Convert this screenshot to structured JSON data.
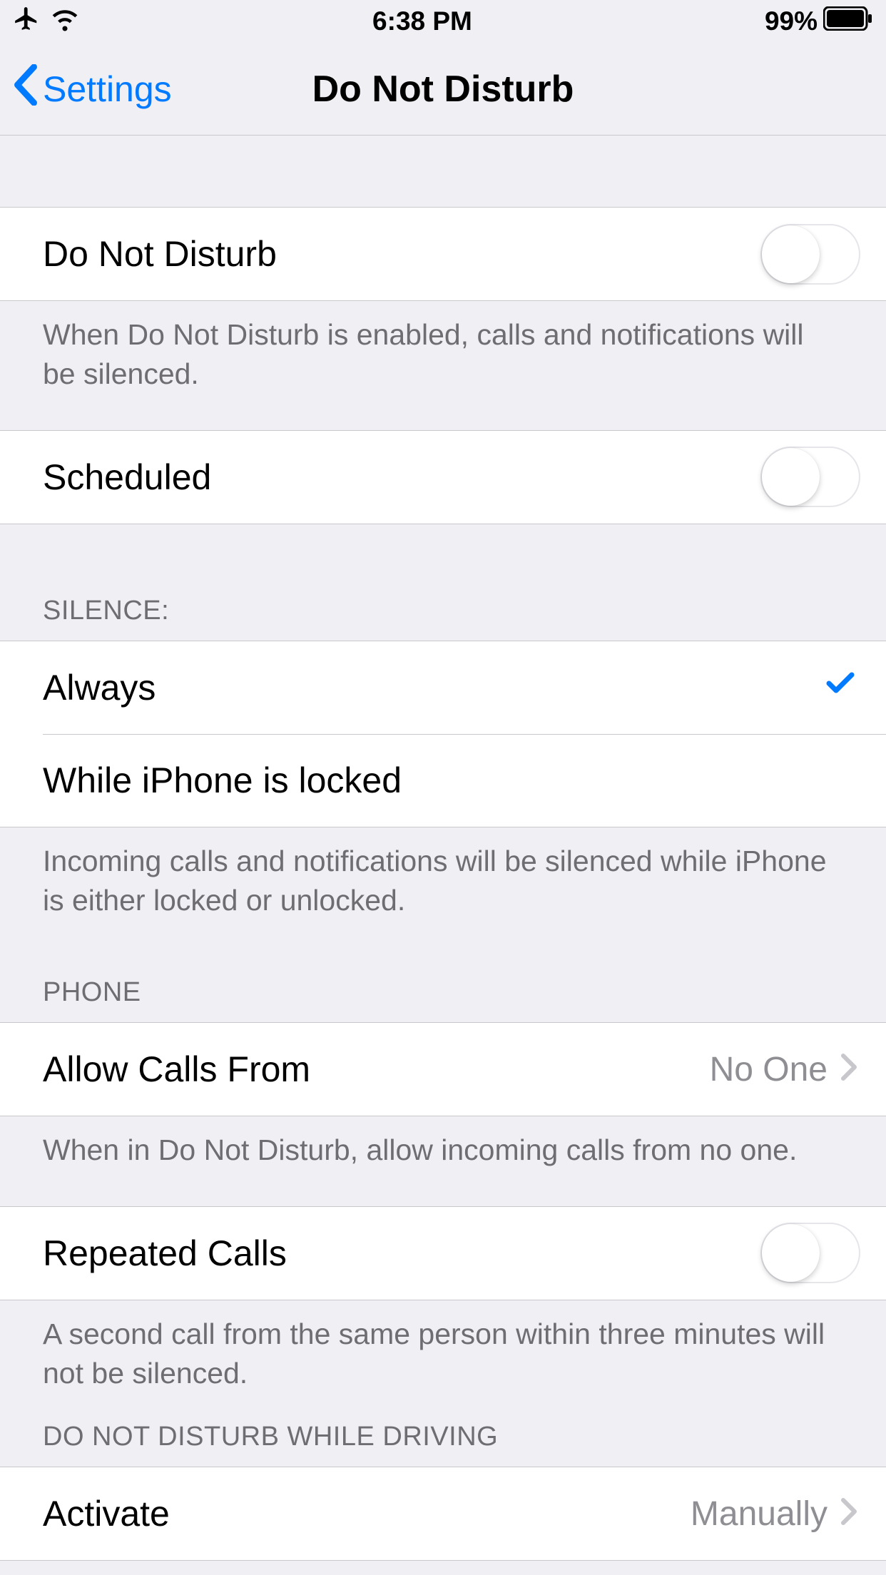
{
  "status": {
    "time": "6:38 PM",
    "battery": "99%",
    "airplane": true,
    "wifi": true
  },
  "nav": {
    "back": "Settings",
    "title": "Do Not Disturb"
  },
  "sections": {
    "dnd": {
      "label": "Do Not Disturb",
      "on": false,
      "footer": "When Do Not Disturb is enabled, calls and notifications will be silenced."
    },
    "scheduled": {
      "label": "Scheduled",
      "on": false
    },
    "silence": {
      "header": "SILENCE:",
      "always": "Always",
      "locked": "While iPhone is locked",
      "selected": "always",
      "footer": "Incoming calls and notifications will be silenced while iPhone is either locked or unlocked."
    },
    "phone": {
      "header": "PHONE",
      "allow_label": "Allow Calls From",
      "allow_value": "No One",
      "allow_footer": "When in Do Not Disturb, allow incoming calls from no one.",
      "repeated_label": "Repeated Calls",
      "repeated_on": false,
      "repeated_footer": "A second call from the same person within three minutes will not be silenced."
    },
    "driving": {
      "header": "DO NOT DISTURB WHILE DRIVING",
      "activate_label": "Activate",
      "activate_value": "Manually"
    }
  }
}
